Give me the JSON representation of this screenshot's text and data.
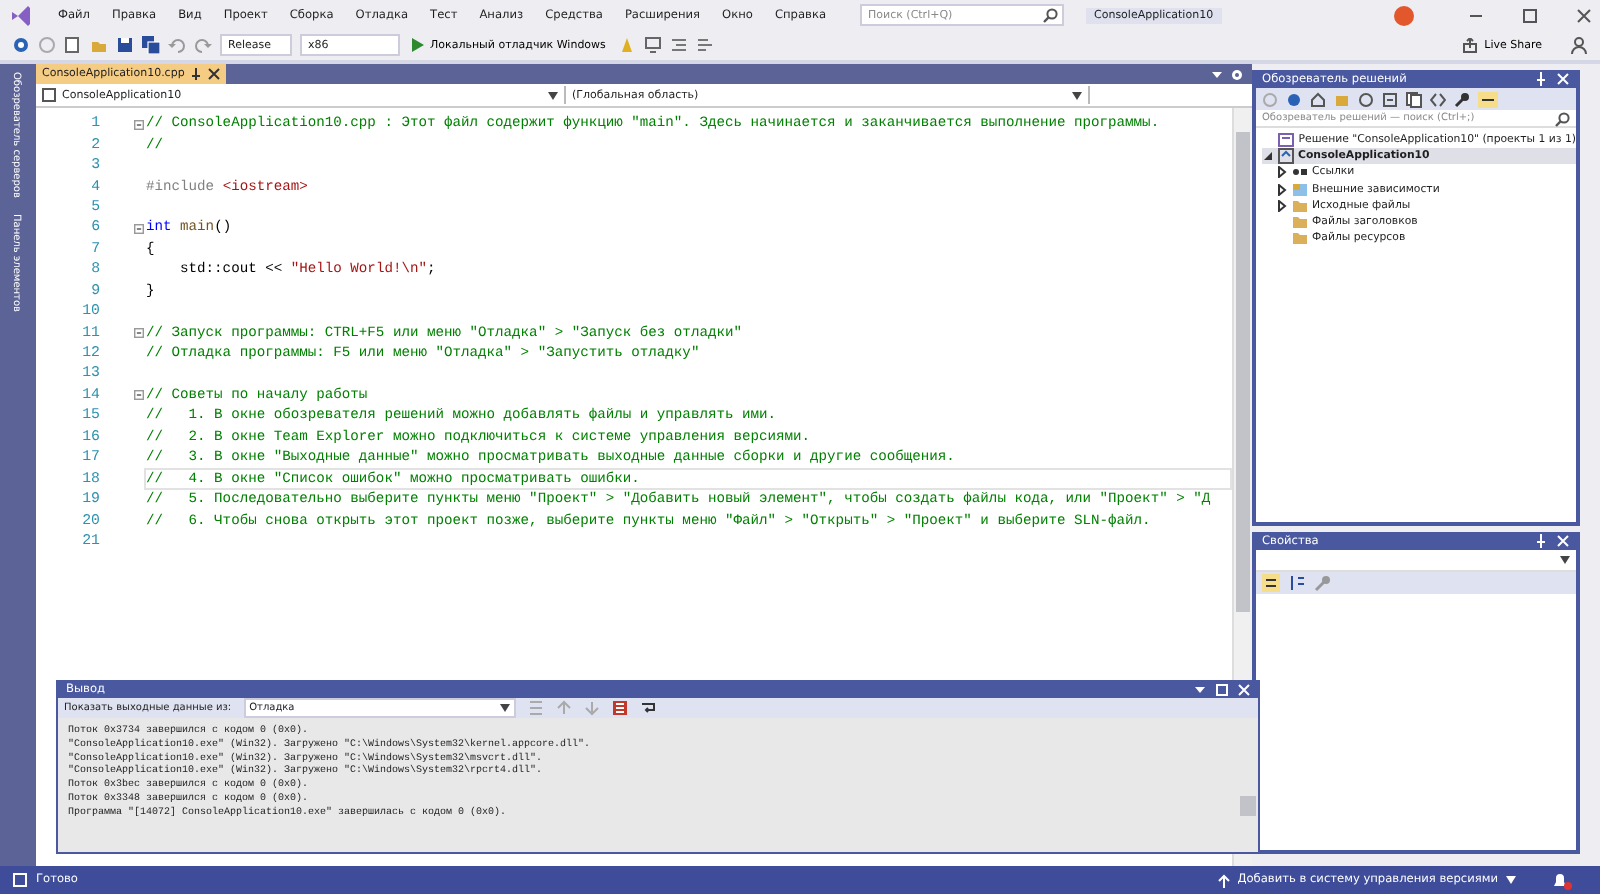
{
  "menu": [
    "Файл",
    "Правка",
    "Вид",
    "Проект",
    "Сборка",
    "Отладка",
    "Тест",
    "Анализ",
    "Средства",
    "Расширения",
    "Окно",
    "Справка"
  ],
  "title_search": {
    "placeholder": "Поиск (Ctrl+Q)"
  },
  "solution_name": "ConsoleApplication10",
  "toolbar": {
    "configuration": "Release",
    "platform": "x86",
    "run": "Локальный отладчик Windows",
    "live_share": "Live Share"
  },
  "side_tabs": [
    "Обозреватель серверов",
    "Панель элементов"
  ],
  "document_tabs": [
    {
      "label": "ConsoleApplication10.cpp",
      "selected": true
    }
  ],
  "navigation": {
    "project": "ConsoleApplication10",
    "scope": "(Глобальная область)"
  },
  "code": {
    "lines": [
      {
        "number": "1",
        "fold": true,
        "current": false,
        "tokens": [
          {
            "kind": "comment",
            "text": "// ConsoleApplication10.cpp : Этот файл содержит функцию \"main\". Здесь начинается и заканчивается выполнение программы."
          }
        ]
      },
      {
        "number": "2",
        "fold": false,
        "current": false,
        "tokens": [
          {
            "kind": "comment",
            "text": "//"
          }
        ]
      },
      {
        "number": "3",
        "fold": false,
        "current": false
      },
      {
        "number": "4",
        "fold": false,
        "current": false,
        "tokens": [
          {
            "kind": "directive",
            "text": "#include "
          },
          {
            "kind": "string",
            "text": "<iostream>"
          }
        ]
      },
      {
        "number": "5",
        "fold": false,
        "current": false
      },
      {
        "number": "6",
        "fold": true,
        "current": false,
        "tokens": [
          {
            "kind": "keyword",
            "text": "int "
          },
          {
            "kind": "function",
            "text": "main"
          },
          {
            "kind": "plain",
            "text": "()"
          }
        ]
      },
      {
        "number": "7",
        "fold": false,
        "current": false,
        "tokens": [
          {
            "kind": "plain",
            "text": "{"
          }
        ]
      },
      {
        "number": "8",
        "fold": false,
        "current": false,
        "tokens": [
          {
            "kind": "plain",
            "text": "    std::cout << "
          },
          {
            "kind": "string",
            "text": "\"Hello World!\\n\""
          },
          {
            "kind": "plain",
            "text": ";"
          }
        ]
      },
      {
        "number": "9",
        "fold": false,
        "current": false,
        "tokens": [
          {
            "kind": "plain",
            "text": "}"
          }
        ]
      },
      {
        "number": "10",
        "fold": false,
        "current": false
      },
      {
        "number": "11",
        "fold": true,
        "current": false,
        "tokens": [
          {
            "kind": "comment",
            "text": "// Запуск программы: CTRL+F5 или меню \"Отладка\" > \"Запуск без отладки\""
          }
        ]
      },
      {
        "number": "12",
        "fold": false,
        "current": false,
        "tokens": [
          {
            "kind": "comment",
            "text": "// Отладка программы: F5 или меню \"Отладка\" > \"Запустить отладку\""
          }
        ]
      },
      {
        "number": "13",
        "fold": false,
        "current": false
      },
      {
        "number": "14",
        "fold": true,
        "current": false,
        "tokens": [
          {
            "kind": "comment",
            "text": "// Советы по началу работы"
          }
        ]
      },
      {
        "number": "15",
        "fold": false,
        "current": false,
        "tokens": [
          {
            "kind": "comment",
            "text": "//   1. В окне обозревателя решений можно добавлять файлы и управлять ими."
          }
        ]
      },
      {
        "number": "16",
        "fold": false,
        "current": false,
        "tokens": [
          {
            "kind": "comment",
            "text": "//   2. В окне Team Explorer можно подключиться к системе управления версиями."
          }
        ]
      },
      {
        "number": "17",
        "fold": false,
        "current": false,
        "tokens": [
          {
            "kind": "comment",
            "text": "//   3. В окне \"Выходные данные\" можно просматривать выходные данные сборки и другие сообщения."
          }
        ]
      },
      {
        "number": "18",
        "fold": false,
        "current": true,
        "tokens": [
          {
            "kind": "comment",
            "text": "//   4. В окне \"Список ошибок\" можно просматривать ошибки."
          }
        ]
      },
      {
        "number": "19",
        "fold": false,
        "current": false,
        "tokens": [
          {
            "kind": "comment",
            "text": "//   5. Последовательно выберите пункты меню \"Проект\" > \"Добавить новый элемент\", чтобы создать файлы кода, или \"Проект\" > \"Д"
          }
        ]
      },
      {
        "number": "20",
        "fold": false,
        "current": false,
        "tokens": [
          {
            "kind": "comment",
            "text": "//   6. Чтобы снова открыть этот проект позже, выберите пункты меню \"Файл\" > \"Открыть\" > \"Проект\" и выберите SLN-файл."
          }
        ]
      },
      {
        "number": "21",
        "fold": false,
        "current": false
      }
    ]
  },
  "solution_explorer": {
    "title": "Обозреватель решений",
    "search": {
      "placeholder": "Обозреватель решений — поиск (Ctrl+;)"
    },
    "tree": [
      {
        "kind": "solution",
        "label": "Решение \"ConsoleApplication10\" (проекты 1 из 1)",
        "selected": false,
        "children": [
          {
            "kind": "project",
            "label": "ConsoleApplication10",
            "expanded": true,
            "selected": true,
            "children": [
              {
                "kind": "references",
                "label": "Ссылки",
                "expanded": false,
                "selected": false
              },
              {
                "kind": "dependencies",
                "label": "Внешние зависимости",
                "expanded": false,
                "selected": false
              },
              {
                "kind": "folder",
                "label": "Исходные файлы",
                "expanded": false,
                "selected": false
              },
              {
                "kind": "folder",
                "label": "Файлы заголовков",
                "selected": false
              },
              {
                "kind": "folder",
                "label": "Файлы ресурсов",
                "selected": false
              }
            ]
          }
        ]
      }
    ]
  },
  "properties": {
    "title": "Свойства"
  },
  "output": {
    "title": "Вывод",
    "source_label": "Показать выходные данные из:",
    "source": "Отладка",
    "lines": [
      "Поток 0x3734 завершился с кодом 0 (0x0).",
      "\"ConsoleApplication10.exe\" (Win32). Загружено \"C:\\Windows\\System32\\kernel.appcore.dll\".",
      "\"ConsoleApplication10.exe\" (Win32). Загружено \"C:\\Windows\\System32\\msvcrt.dll\".",
      "\"ConsoleApplication10.exe\" (Win32). Загружено \"C:\\Windows\\System32\\rpcrt4.dll\".",
      "Поток 0x3bec завершился с кодом 0 (0x0).",
      "Поток 0x3348 завершился с кодом 0 (0x0).",
      "Программа \"[14072] ConsoleApplication10.exe\" завершилась с кодом 0 (0x0)."
    ]
  },
  "status_bar": {
    "state": "Готово",
    "source_control": "Добавить в систему управления версиями"
  }
}
